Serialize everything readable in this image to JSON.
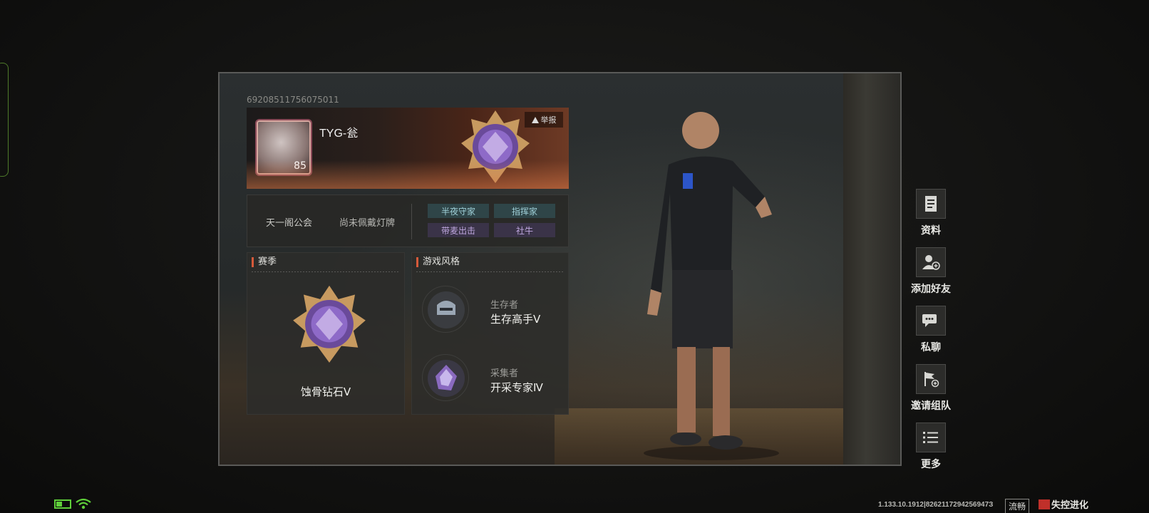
{
  "profile": {
    "player_id": "69208511756075011",
    "name": "TYG-瓮",
    "level": "85",
    "report_label": "举报"
  },
  "info": {
    "guild": "天一阁公会",
    "lamp": "尚未佩戴灯牌",
    "tags": [
      {
        "label": "半夜守家",
        "color": "blue"
      },
      {
        "label": "指挥家",
        "color": "blue"
      },
      {
        "label": "带麦出击",
        "color": "purple"
      },
      {
        "label": "社牛",
        "color": "purple"
      }
    ]
  },
  "season": {
    "title": "赛季",
    "rank": "蚀骨钻石Ⅴ"
  },
  "play_style": {
    "title": "游戏风格",
    "items": [
      {
        "subtitle": "生存者",
        "value": "生存高手Ⅴ"
      },
      {
        "subtitle": "采集者",
        "value": "开采专家Ⅳ"
      }
    ]
  },
  "side_menu": [
    {
      "label": "资料",
      "icon": "document-icon"
    },
    {
      "label": "添加好友",
      "icon": "add-friend-icon"
    },
    {
      "label": "私聊",
      "icon": "chat-icon"
    },
    {
      "label": "邀请组队",
      "icon": "flag-icon"
    },
    {
      "label": "更多",
      "icon": "list-icon"
    }
  ],
  "footer": {
    "version": "1.133.10.1912|8262117294256947З",
    "network": "流畅",
    "logo": "失控进化"
  },
  "colors": {
    "accent": "#d65a3a",
    "tag_blue": "#9fd0d8",
    "tag_purple": "#c0a8e0",
    "battery": "#5fcf3a"
  }
}
